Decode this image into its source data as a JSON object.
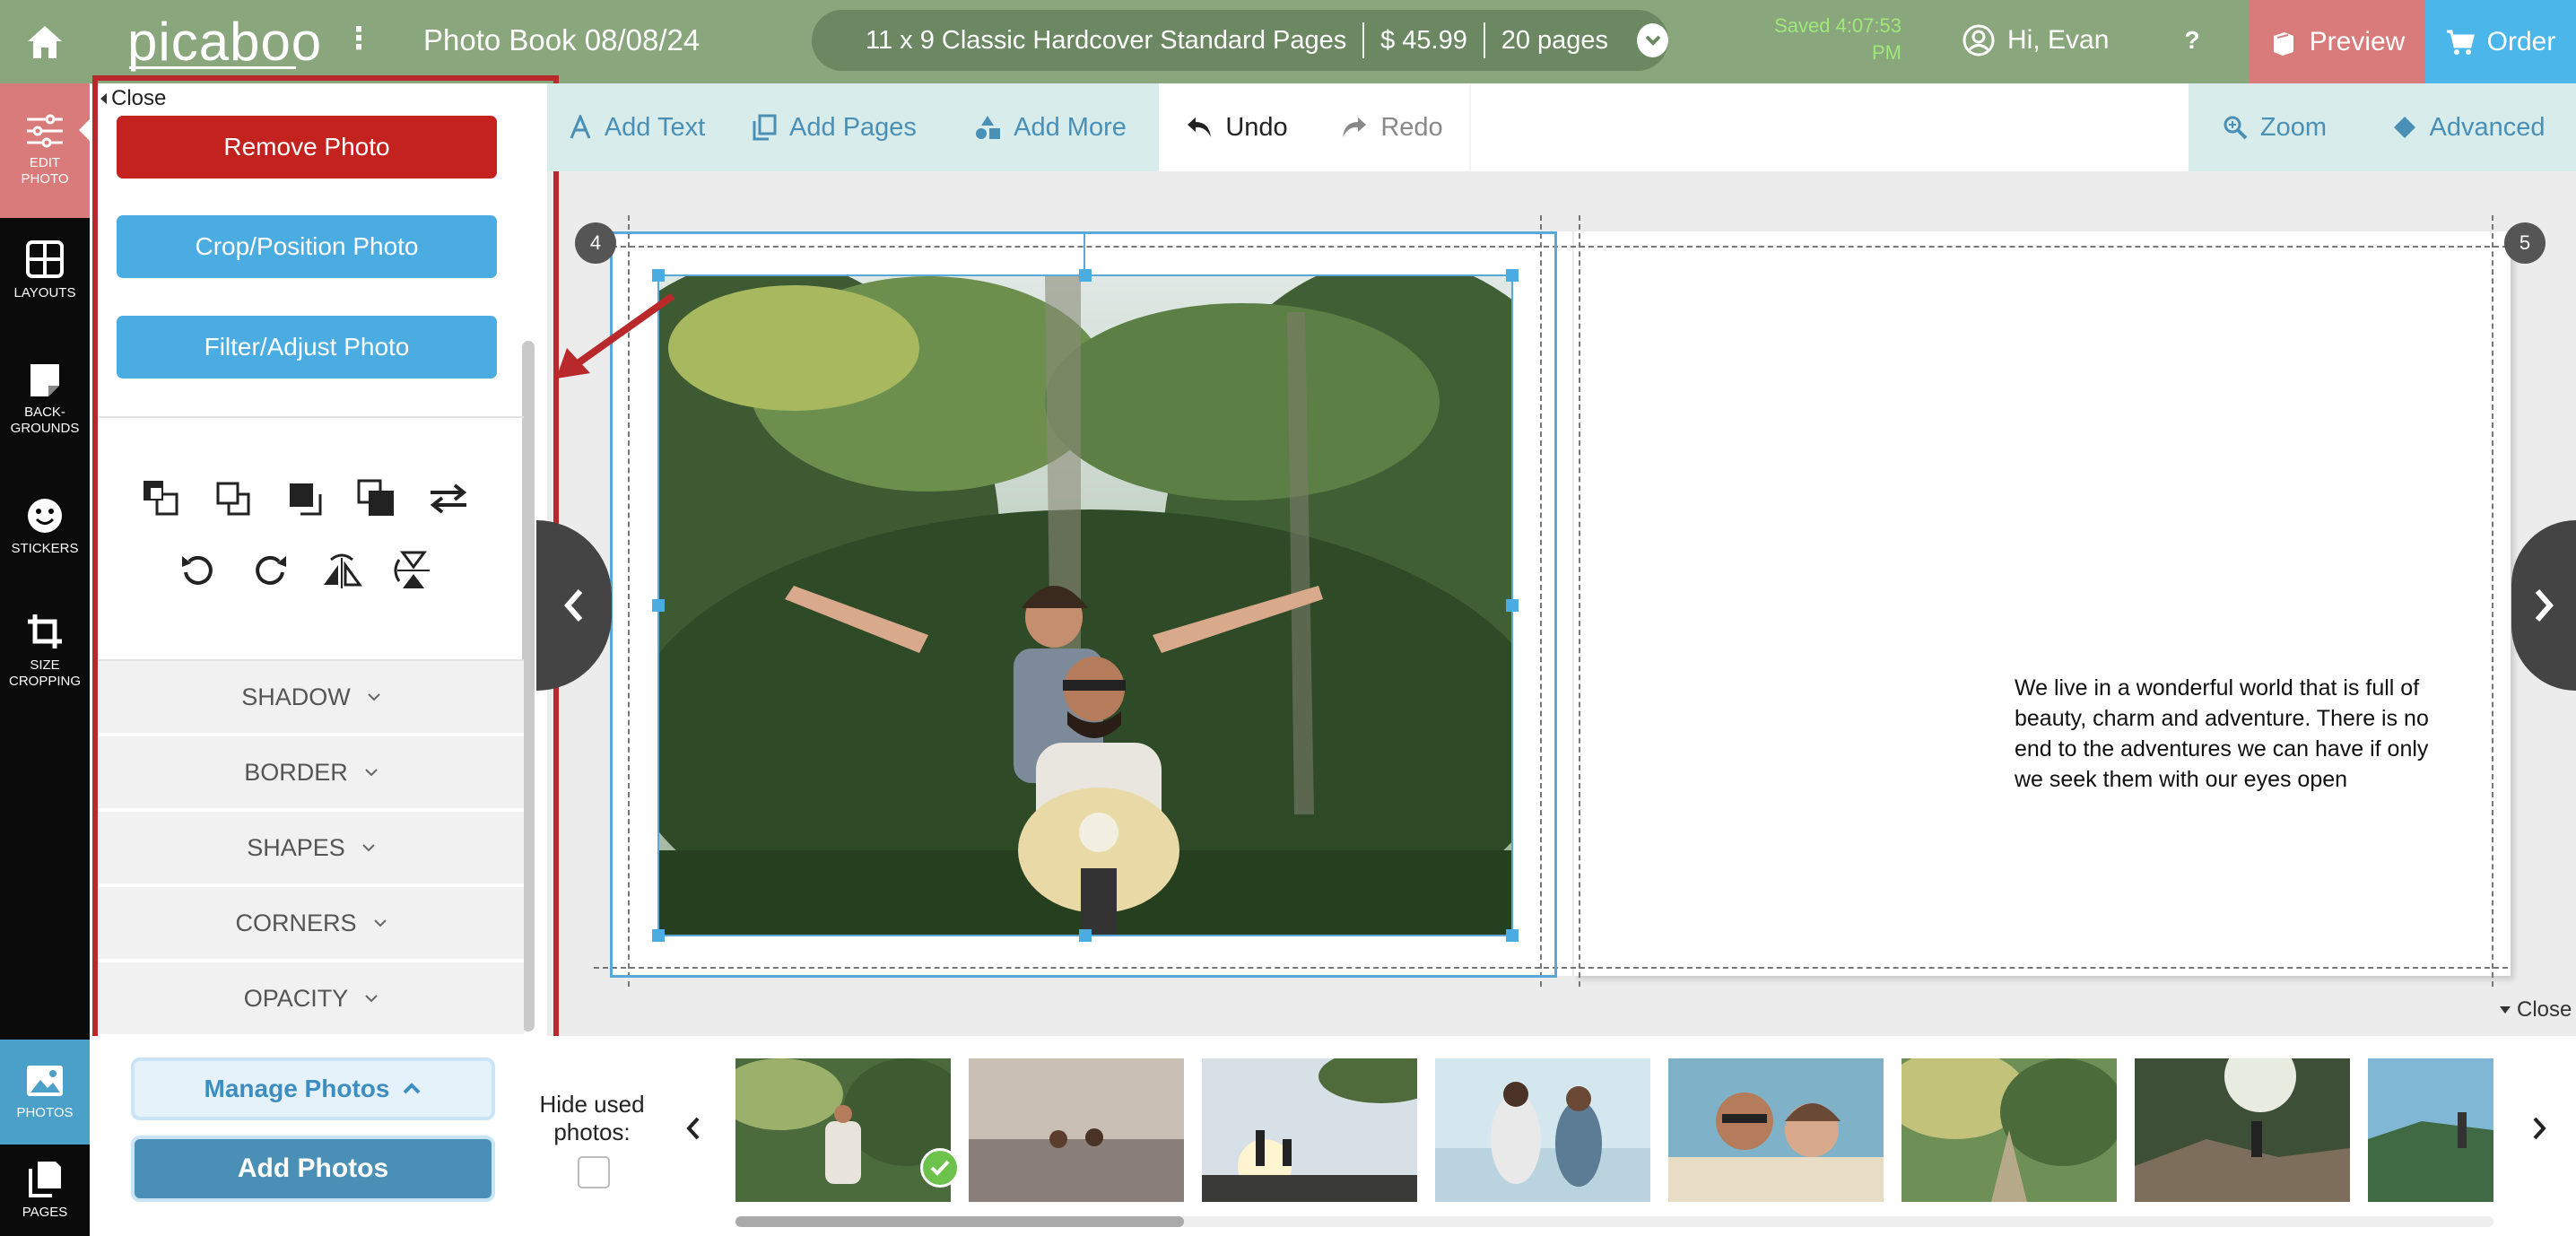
{
  "app": {
    "logo": "picaboo",
    "project_title": "Photo Book 08/08/24",
    "product": {
      "spec": "11 x 9 Classic Hardcover Standard Pages",
      "price": "$ 45.99",
      "pages": "20 pages"
    },
    "saved_status": "Saved 4:07:53 PM",
    "greeting": "Hi, Evan",
    "help": "?",
    "preview_label": "Preview",
    "order_label": "Order",
    "colors": {
      "topbar": "#8aa67d",
      "preview": "#d97b7b",
      "order": "#4ab6e9",
      "remove": "#c4221e",
      "action_blue": "#4aace0",
      "highlight": "#b9282a"
    }
  },
  "leftnav": {
    "items": [
      {
        "label": "EDIT PHOTO",
        "icon": "sliders-icon"
      },
      {
        "label": "LAYOUTS",
        "icon": "grid-icon"
      },
      {
        "label": "BACK-GROUNDS",
        "icon": "note-icon"
      },
      {
        "label": "STICKERS",
        "icon": "smiley-icon"
      },
      {
        "label": "SIZE CROPPING",
        "icon": "crop-icon"
      },
      {
        "label": "PHOTOS",
        "icon": "image-icon"
      },
      {
        "label": "PAGES",
        "icon": "pages-icon"
      }
    ]
  },
  "edit_panel": {
    "close_label": "Close",
    "remove_label": "Remove Photo",
    "crop_label": "Crop/Position Photo",
    "filter_label": "Filter/Adjust Photo",
    "tools_row1": [
      "bring-forward-icon",
      "send-backward-icon",
      "bring-to-front-icon",
      "send-to-back-icon",
      "swap-icon"
    ],
    "tools_row2": [
      "rotate-left-icon",
      "rotate-right-icon",
      "flip-horizontal-icon",
      "flip-vertical-icon"
    ],
    "sections": [
      "SHADOW",
      "BORDER",
      "SHAPES",
      "CORNERS",
      "OPACITY"
    ]
  },
  "toolbar": {
    "add_text": "Add Text",
    "add_pages": "Add Pages",
    "add_more": "Add More",
    "undo": "Undo",
    "redo": "Redo",
    "zoom": "Zoom",
    "advanced": "Advanced"
  },
  "canvas": {
    "left_page_number": "4",
    "right_page_number": "5",
    "page_text": "We live in a wonderful world that is full of beauty, charm and adventure. There is no end to the adventures we can have if only we seek them with our eyes open",
    "close_label": "Close"
  },
  "tray": {
    "manage_photos": "Manage Photos",
    "add_photos": "Add Photos",
    "hide_used": "Hide used photos:"
  }
}
